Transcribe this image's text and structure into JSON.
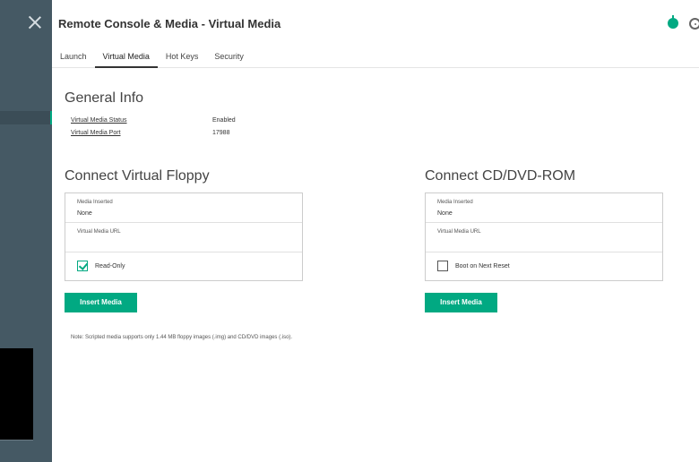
{
  "header": {
    "title": "Remote Console & Media - Virtual Media",
    "tabs": [
      "Launch",
      "Virtual Media",
      "Hot Keys",
      "Security"
    ],
    "active_tab": "Virtual Media"
  },
  "general_info": {
    "heading": "General Info",
    "fields": [
      {
        "label": "Virtual Media Status",
        "value": "Enabled"
      },
      {
        "label": "Virtual Media Port",
        "value": "17988"
      }
    ]
  },
  "floppy": {
    "heading": "Connect Virtual Floppy",
    "media_inserted_label": "Media Inserted",
    "media_inserted_value": "None",
    "url_label": "Virtual Media URL",
    "checkbox_label": "Read-Only",
    "checkbox_checked": true,
    "button_label": "Insert Media"
  },
  "cdrom": {
    "heading": "Connect CD/DVD-ROM",
    "media_inserted_label": "Media Inserted",
    "media_inserted_value": "None",
    "url_label": "Virtual Media URL",
    "checkbox_label": "Boot on Next Reset",
    "checkbox_checked": false,
    "button_label": "Insert Media"
  },
  "note": "Note: Scripted media supports only 1.44 MB floppy images (.img) and CD/DVD images (.iso).",
  "colors": {
    "accent": "#01a982",
    "sidebar": "#455964"
  },
  "icons": [
    "close-icon",
    "health-status-icon",
    "power-icon",
    "checkbox-icon"
  ]
}
